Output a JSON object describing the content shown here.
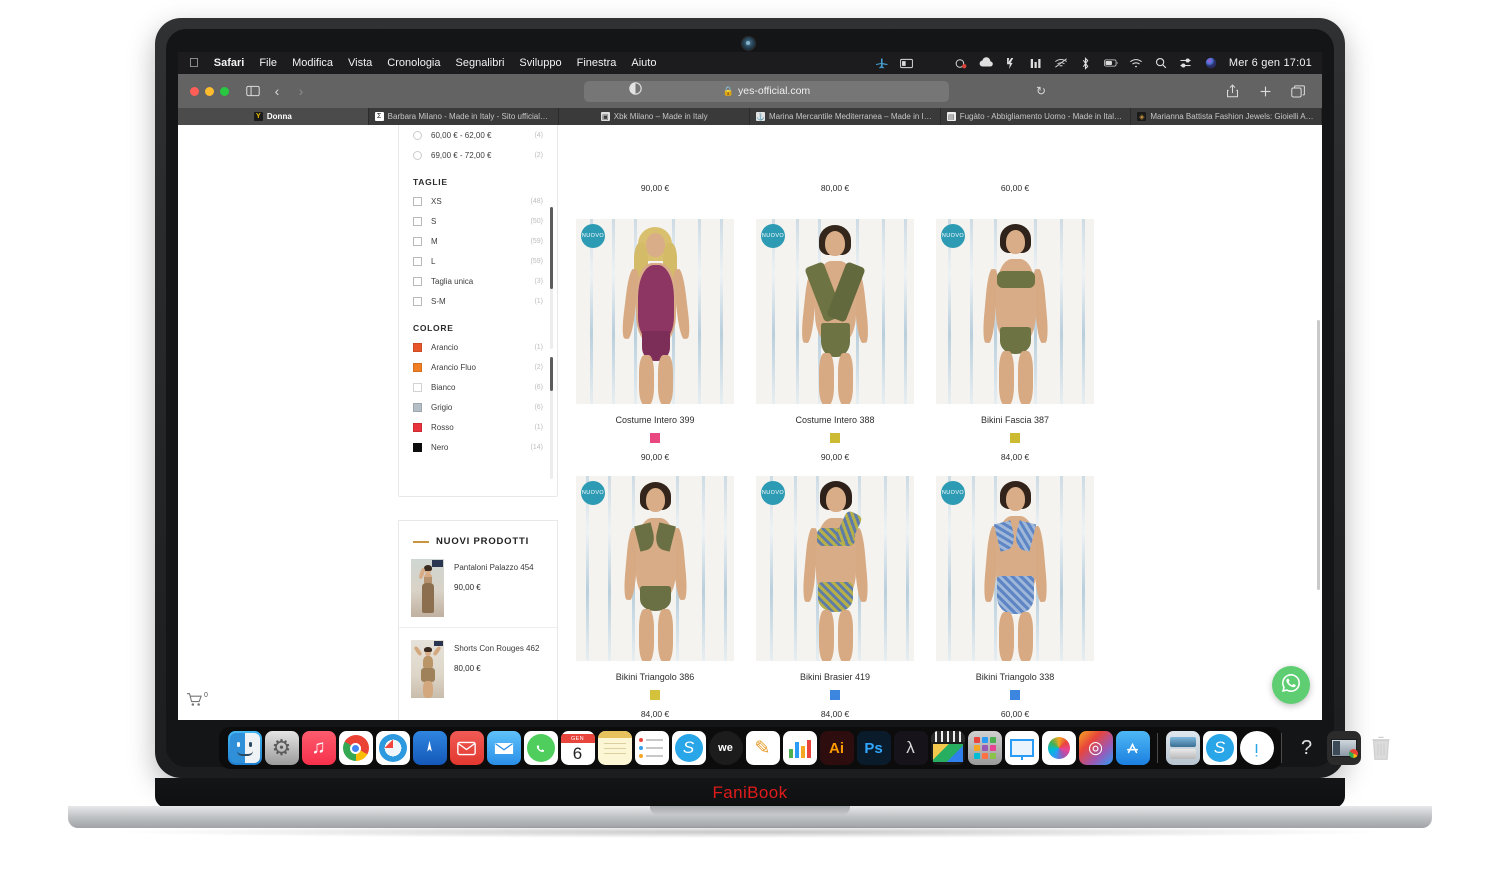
{
  "menubar": {
    "apple": "",
    "items": [
      "Safari",
      "File",
      "Modifica",
      "Vista",
      "Cronologia",
      "Segnalibri",
      "Sviluppo",
      "Finestra",
      "Aiuto"
    ],
    "status_icons": [
      "airplane-icon",
      "display-icon",
      "dropbox-icon",
      "cloud-icon",
      "adobe-icon",
      "stats-icon",
      "wifi-off-icon",
      "bluetooth-icon",
      "battery-icon",
      "wifi-icon",
      "search-icon",
      "control-center-icon",
      "siri-icon"
    ],
    "clock": "Mer 6 gen  17:01"
  },
  "toolbar": {
    "sidebar_icon": "sidebar-icon",
    "back_icon": "back-arrow-icon",
    "forward_icon": "forward-arrow-icon",
    "reader_icon": "reader-view-icon",
    "lock": "🔒",
    "url": "yes-official.com",
    "reload_icon": "reload-icon",
    "share_icon": "share-icon",
    "new_tab_icon": "plus-icon",
    "tab_overview_icon": "tab-overview-icon"
  },
  "tabs": [
    {
      "label": "Donna",
      "favicon": "Y",
      "favicon_color": "#f2c300",
      "favicon_bg": "#1a1a1a",
      "active": true
    },
    {
      "label": "Barbara Milano - Made in Italy - Sito ufficiale -...",
      "favicon": "Σ",
      "favicon_color": "#1a1a1a",
      "favicon_bg": "#ffffff",
      "active": false
    },
    {
      "label": "Xbk Milano – Made in Italy",
      "favicon": "▣",
      "favicon_color": "#3a3a3a",
      "favicon_bg": "#dddddd",
      "active": false
    },
    {
      "label": "Marina Mercantile Mediterranea – Made in Italy",
      "favicon": "⚓",
      "favicon_color": "#333333",
      "favicon_bg": "#e4e4e4",
      "active": false
    },
    {
      "label": "Fugàto - Abbigliamento Uomo - Made in Italy -...",
      "favicon": "▤",
      "favicon_color": "#555555",
      "favicon_bg": "#f0f0f0",
      "active": false
    },
    {
      "label": "Marianna Battista Fashion Jewels: Gioielli Artigi...",
      "favicon": "◈",
      "favicon_color": "#c8953e",
      "favicon_bg": "#1a1a1a",
      "active": false
    }
  ],
  "sidebar": {
    "price_filters": [
      {
        "label": "60,00 € - 62,00 €",
        "count": "(4)",
        "selected": false
      },
      {
        "label": "69,00 € - 72,00 €",
        "count": "(2)",
        "selected": false
      }
    ],
    "sizes_title": "TAGLIE",
    "sizes": [
      {
        "label": "XS",
        "count": "(48)",
        "checked": false
      },
      {
        "label": "S",
        "count": "(50)",
        "checked": false
      },
      {
        "label": "M",
        "count": "(59)",
        "checked": false
      },
      {
        "label": "L",
        "count": "(59)",
        "checked": false
      },
      {
        "label": "Taglia unica",
        "count": "(3)",
        "checked": false
      },
      {
        "label": "S-M",
        "count": "(1)",
        "checked": false
      }
    ],
    "colors_title": "COLORE",
    "colors": [
      {
        "label": "Arancio",
        "count": "(1)",
        "hex": "#e8572b"
      },
      {
        "label": "Arancio Fluo",
        "count": "(2)",
        "hex": "#ef7e24"
      },
      {
        "label": "Bianco",
        "count": "(6)",
        "hex": "#ffffff"
      },
      {
        "label": "Grigio",
        "count": "(6)",
        "hex": "#b4bec6"
      },
      {
        "label": "Rosso",
        "count": "(1)",
        "hex": "#e8323c"
      },
      {
        "label": "Nero",
        "count": "(14)",
        "hex": "#0d0d0d"
      }
    ],
    "new_products_title": "NUOVI PRODOTTI",
    "new_products": [
      {
        "name": "Pantaloni Palazzo 454",
        "price": "90,00 €"
      },
      {
        "name": "Shorts Con Rouges 462",
        "price": "80,00 €"
      }
    ]
  },
  "grid": {
    "badge_label": "NUOVO",
    "badge_color": "#2d9bb3",
    "top_row_prices": [
      "90,00 €",
      "80,00 €",
      "60,00 €"
    ],
    "rows": [
      [
        {
          "name": "Costume Intero 399",
          "price": "90,00 €",
          "swatch": "#e8487f",
          "suit_color": "#8d3563",
          "style": "onepiece-fringe"
        },
        {
          "name": "Costume Intero 388",
          "price": "90,00 €",
          "swatch": "#ccbb32",
          "suit_color": "#6e7343",
          "style": "onepiece-cross"
        },
        {
          "name": "Bikini Fascia 387",
          "price": "84,00 €",
          "swatch": "#ccbb32",
          "suit_color": "#6e7343",
          "style": "bandeau"
        }
      ],
      [
        {
          "name": "Bikini Triangolo 386",
          "price": "84,00 €",
          "swatch": "#d4c13c",
          "suit_color": "#6b7044",
          "style": "triangle"
        },
        {
          "name": "Bikini Brasier 419",
          "price": "84,00 €",
          "swatch": "#3d86e0",
          "suit_color": "#b5b04a",
          "style": "brasier"
        },
        {
          "name": "Bikini Triangolo 338",
          "price": "60,00 €",
          "swatch": "#3d86e0",
          "suit_color": "#5e85c4",
          "style": "triangle-high"
        }
      ]
    ]
  },
  "floating": {
    "cart_icon": "shopping-cart-icon",
    "cart_count": "0",
    "whatsapp_icon": "whatsapp-icon"
  },
  "dock": {
    "items": [
      {
        "name": "finder",
        "glyph": "☺",
        "bg": "#3aa0e8",
        "running": true
      },
      {
        "name": "system-preferences",
        "glyph": "⚙",
        "bg": "#a9a9a9",
        "running": false
      },
      {
        "name": "music",
        "glyph": "♫",
        "bg": "#fa3c4c",
        "running": false
      },
      {
        "name": "chrome",
        "glyph": "◉",
        "bg": "#ffffff",
        "running": true
      },
      {
        "name": "safari",
        "glyph": "🧭",
        "bg": "#ffffff",
        "running": true
      },
      {
        "name": "spark-mail",
        "glyph": "➤",
        "bg": "#1f6fd0",
        "running": true
      },
      {
        "name": "airmail",
        "glyph": "✉",
        "bg": "#ed4a44",
        "running": false
      },
      {
        "name": "mail",
        "glyph": "✉",
        "bg": "#3fa9f5",
        "running": true
      },
      {
        "name": "whatsapp",
        "glyph": "✆",
        "bg": "#4fce5d",
        "running": true
      },
      {
        "name": "calendar",
        "glyph": "6",
        "bg": "#ffffff",
        "running": true
      },
      {
        "name": "notes",
        "glyph": "▤",
        "bg": "#fbf3cf",
        "running": false
      },
      {
        "name": "reminders",
        "glyph": "☰",
        "bg": "#ffffff",
        "running": false
      },
      {
        "name": "skype",
        "glyph": "S",
        "bg": "#29a6e8",
        "running": false
      },
      {
        "name": "wetransfer",
        "glyph": "we",
        "bg": "#1c1c1c",
        "running": false
      },
      {
        "name": "pages",
        "glyph": "✎",
        "bg": "#ffffff",
        "running": false
      },
      {
        "name": "numbers",
        "glyph": "▮",
        "bg": "#ffffff",
        "running": false
      },
      {
        "name": "illustrator",
        "glyph": "Ai",
        "bg": "#2d0d0d",
        "running": false
      },
      {
        "name": "photoshop",
        "glyph": "Ps",
        "bg": "#0a1b2c",
        "running": false
      },
      {
        "name": "acrobat",
        "glyph": "λ",
        "bg": "#18141c",
        "running": false
      },
      {
        "name": "final-cut",
        "glyph": "▧",
        "bg": "#1b1b1b",
        "running": false
      },
      {
        "name": "launchpad",
        "glyph": "▦",
        "bg": "#9a9a9a",
        "running": false
      },
      {
        "name": "keynote",
        "glyph": "▣",
        "bg": "#ffffff",
        "running": false
      },
      {
        "name": "photos",
        "glyph": "✿",
        "bg": "#ffffff",
        "running": false
      },
      {
        "name": "creative-cloud",
        "glyph": "◎",
        "bg": "#e02020",
        "running": false
      },
      {
        "name": "app-store",
        "glyph": "A",
        "bg": "#2b9cf6",
        "running": false
      }
    ],
    "items_right": [
      {
        "name": "downloads-stack",
        "glyph": "▤",
        "bg": "#cdd7e0",
        "running": false
      },
      {
        "name": "skype-2",
        "glyph": "S",
        "bg": "#29a6e8",
        "running": false
      },
      {
        "name": "wacom",
        "glyph": "ɯ",
        "bg": "#ffffff",
        "running": false
      }
    ],
    "items_far_right": [
      {
        "name": "help",
        "glyph": "?",
        "bg": "transparent",
        "running": false
      },
      {
        "name": "screenshot-folder",
        "glyph": "🖼",
        "bg": "#2a2a2a",
        "running": false
      },
      {
        "name": "trash",
        "glyph": "🗑",
        "bg": "transparent",
        "running": false
      }
    ]
  },
  "laptop": {
    "brand": "FaniBook"
  }
}
